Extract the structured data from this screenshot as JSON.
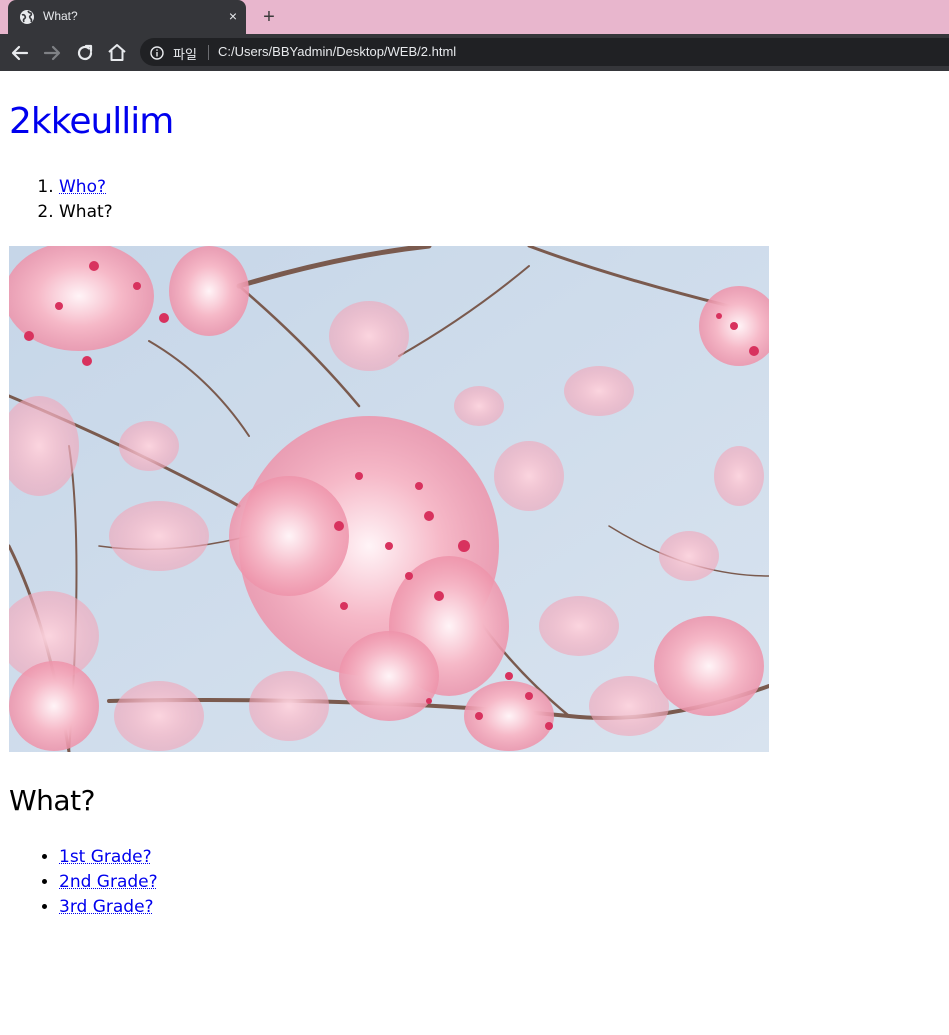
{
  "browser": {
    "tab_title": "What?",
    "close_glyph": "×",
    "new_tab_glyph": "+",
    "scheme_label": "파일",
    "url": "C:/Users/BBYadmin/Desktop/WEB/2.html",
    "tabbar_color": "#e8b6cd",
    "chrome_color": "#35363a"
  },
  "page": {
    "heading": "2kkeullim",
    "nav": [
      {
        "label": "Who?"
      },
      {
        "label": "What?"
      }
    ],
    "image_subject": "cherry-blossom-photo",
    "section_title": "What?",
    "links": [
      {
        "label": "1st Grade?"
      },
      {
        "label": "2nd Grade?"
      },
      {
        "label": "3rd Grade?"
      }
    ],
    "link_color": "#0000ee"
  }
}
